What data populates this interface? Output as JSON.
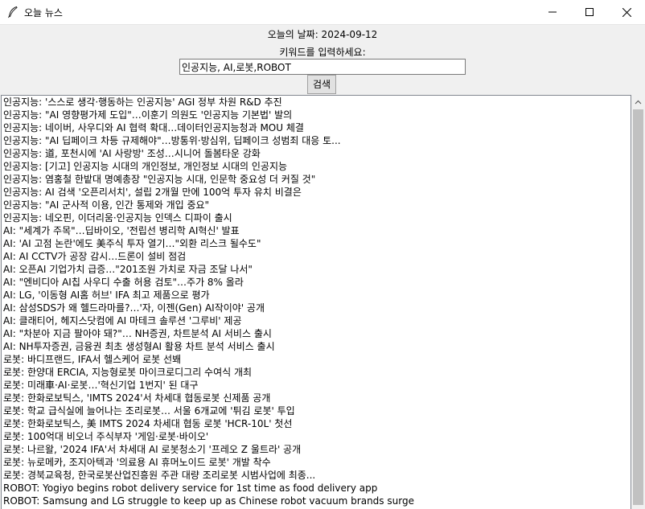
{
  "window": {
    "title": "오늘 뉴스",
    "icon": "feather-icon"
  },
  "header": {
    "date_label": "오늘의 날짜: 2024-09-12",
    "keyword_prompt": "키워드를 입력하세요:",
    "keyword_value": "인공지능, AI,로봇,ROBOT",
    "search_label": "검색"
  },
  "results": [
    "인공지능: '스스로 생각·행동하는 인공지능' AGI 정부 차원 R&D 추진",
    "인공지능: \"AI 영향평가제 도입\"…이훈기 의원도 '인공지능 기본법' 발의",
    "인공지능: 네이버, 사우디와 AI 협력 확대…데이터인공지능청과 MOU 체결",
    "인공지능: \"AI 딥페이크 차등 규제해야\"…방통위·방심위, 딥페이크 성범죄 대응 토...",
    "인공지능: 道, 포천시에 'AI 사랑방' 조성…시니어 돌봄타운 강화",
    "인공지능: [기고] 인공지능 시대의 개인정보, 개인정보 시대의 인공지능",
    "인공지능: 염홍철 한밭대 명예총장 \"인공지능 시대, 인문학 중요성 더 커질 것\"",
    "인공지능: AI 검색 '오픈리서치', 설립 2개월 만에 100억 투자 유치 비결은",
    "인공지능: \"AI 군사적 이용, 인간 통제와 개입 중요\"",
    "인공지능: 네오핀, 이더리움·인공지능 인덱스 디파이 출시",
    "AI: \"세계가 주목\"…딥바이오, '전립선 병리학 AI혁신' 발표",
    "AI: 'AI 고점 논란'에도 美주식 투자 열기…\"외환 리스크 될수도\"",
    "AI: AI CCTV가 공장 감시…드론이 설비 점검",
    "AI: 오픈AI 기업가치 급증…\"201조원 가치로 자금 조달 나서\"",
    "AI: \"엔비디아 AI칩 사우디 수출 허용 검토\"…주가 8% 올라",
    "AI: LG, '이동형 AI홈 허브' IFA 최고 제품으로 평가",
    "AI: 삼성SDS가 왜 헬드라마를?…'자, 이젠(Gen) AI작이야' 공개",
    "AI: 클래티어, 헤지스닷컴에 AI 마테크 솔루션 '그루비' 제공",
    "AI: \"차분아 지금 팔아야 돼?\"… NH증권, 차트분석 AI 서비스 출시",
    "AI: NH투자증권, 금융권 최초 생성형AI 활용 차트 분석 서비스 출시",
    "로봇: 바디프랜드, IFA서 헬스케어 로봇 선봬",
    "로봇: 한양대 ERCIA, 지능형로봇 마이크로디그리 수여식 개최",
    "로봇: 미래車·AI·로봇…'혁신기업 1번지' 된 대구",
    "로봇: 한화로보틱스, 'IMTS 2024'서 차세대 협동로봇 신제품 공개",
    "로봇: 학교 급식실에 늘어나는 조리로봇… 서울 6개교에 '튀김 로봇' 투입",
    "로봇: 한화로보틱스, 美 IMTS 2024 차세대 협동 로봇 'HCR-10L' 첫선",
    "로봇: 100억대 비오너 주식부자 '게임·로봇·바이오'",
    "로봇: 나르왈, '2024 IFA'서 차세대 AI 로봇청소기 '프레오 Z 울트라' 공개",
    "로봇: 뉴로메카, 조지아텍과 '의료용 AI 휴머노이드 로봇' 개발 착수",
    "로봇: 경북교육청, 한국로봇산업진흥원 주관 대량 조리로봇 시범사업에 최종...",
    "ROBOT: Yogiyo begins robot delivery service for 1st time as food delivery app",
    "ROBOT: Samsung and LG struggle to keep up as Chinese robot vacuum brands surge"
  ]
}
